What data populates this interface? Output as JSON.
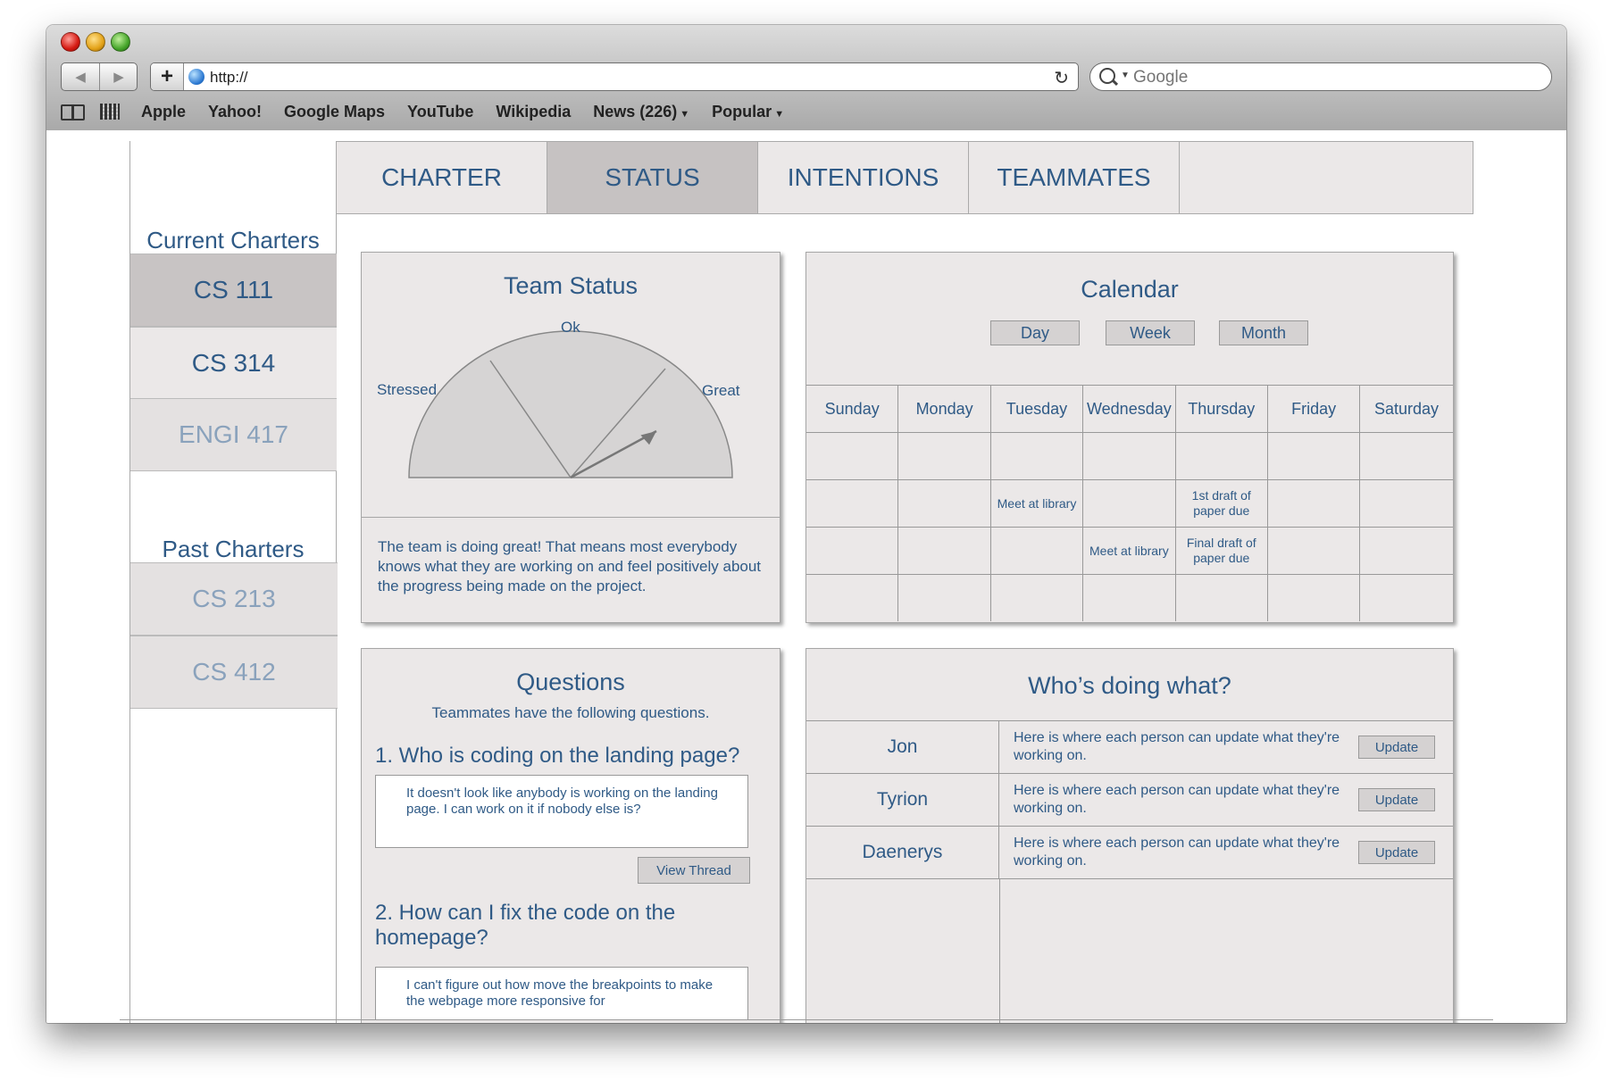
{
  "browser": {
    "url": "http://",
    "search_placeholder": "Google",
    "bookmarks": [
      "Apple",
      "Yahoo!",
      "Google Maps",
      "YouTube",
      "Wikipedia",
      "News (226)",
      "Popular"
    ]
  },
  "sidebar": {
    "current_header": "Current Charters",
    "current": [
      "CS 111",
      "CS 314",
      "ENGI 417"
    ],
    "past_header": "Past Charters",
    "past": [
      "CS 213",
      "CS 412"
    ]
  },
  "tabs": [
    "CHARTER",
    "STATUS",
    "INTENTIONS",
    "TEAMMATES"
  ],
  "active_tab": "STATUS",
  "team_status": {
    "title": "Team Status",
    "labels": {
      "left": "Stressed",
      "middle": "Ok",
      "right": "Great"
    },
    "description": "The team is doing great! That means most everybody knows what they are working on and feel positively about the progress being made on the project."
  },
  "calendar": {
    "title": "Calendar",
    "views": [
      "Day",
      "Week",
      "Month"
    ],
    "days": [
      "Sunday",
      "Monday",
      "Tuesday",
      "Wednesday",
      "Thursday",
      "Friday",
      "Saturday"
    ],
    "weeks": [
      [
        "",
        "",
        "",
        "",
        "",
        "",
        ""
      ],
      [
        "",
        "",
        "Meet at library",
        "",
        "1st draft of paper due",
        "",
        ""
      ],
      [
        "",
        "",
        "",
        "Meet at library",
        "Final draft of paper due",
        "",
        ""
      ],
      [
        "",
        "",
        "",
        "",
        "",
        "",
        ""
      ]
    ]
  },
  "questions": {
    "title": "Questions",
    "subtitle": "Teammates have the following questions.",
    "items": [
      {
        "question": "1. Who is coding on the landing page?",
        "answer": "It doesn't look like anybody is working on the landing page. I can work on it if nobody else is?"
      },
      {
        "question": "2. How can I fix the code on the homepage?",
        "answer": "I can't figure out how move the breakpoints to make the webpage more responsive for"
      }
    ],
    "view_thread_label": "View Thread"
  },
  "who": {
    "title": "Who’s doing what?",
    "update_label": "Update",
    "rows": [
      {
        "name": "Jon",
        "text": "Here is where each person can update what they're working on."
      },
      {
        "name": "Tyrion",
        "text": "Here is where each person can update what they're working on."
      },
      {
        "name": "Daenerys",
        "text": "Here is where each person can update what they're working on."
      }
    ]
  }
}
